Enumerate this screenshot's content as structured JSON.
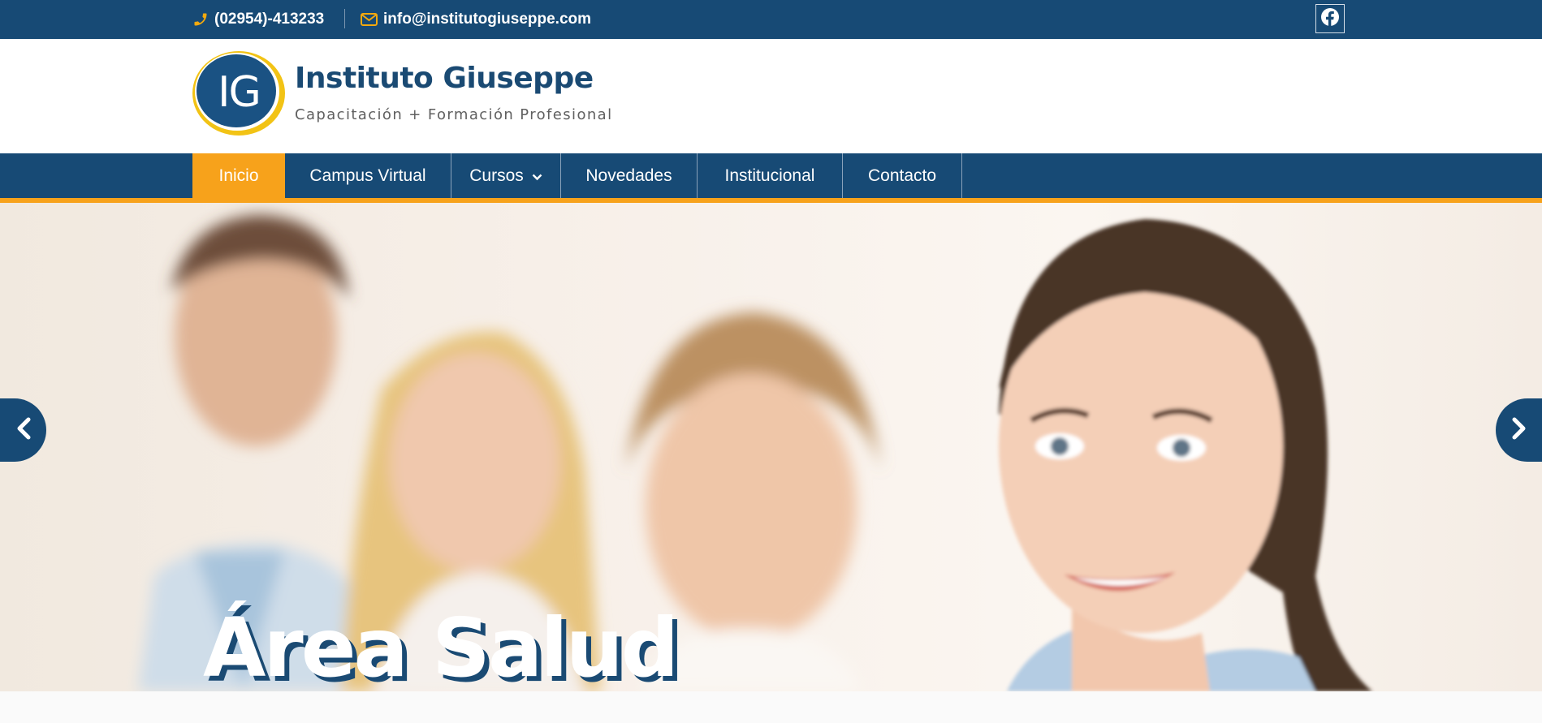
{
  "topbar": {
    "phone": "(02954)-413233",
    "email": "info@institutogiuseppe.com",
    "social": "facebook-icon"
  },
  "header": {
    "logo_text": "IG",
    "title": "Instituto Giuseppe",
    "tagline": "Capacitación + Formación Profesional"
  },
  "nav": {
    "items": [
      {
        "label": "Inicio",
        "active": true
      },
      {
        "label": "Campus Virtual"
      },
      {
        "label": "Cursos",
        "has_dropdown": true
      },
      {
        "label": "Novedades"
      },
      {
        "label": "Institucional"
      },
      {
        "label": "Contacto"
      }
    ]
  },
  "slider": {
    "caption": "Área Salud"
  },
  "colors": {
    "brand_blue": "#174a75",
    "accent_orange": "#f7a21b",
    "icon_orange": "#f3a90e",
    "white": "#ffffff"
  }
}
